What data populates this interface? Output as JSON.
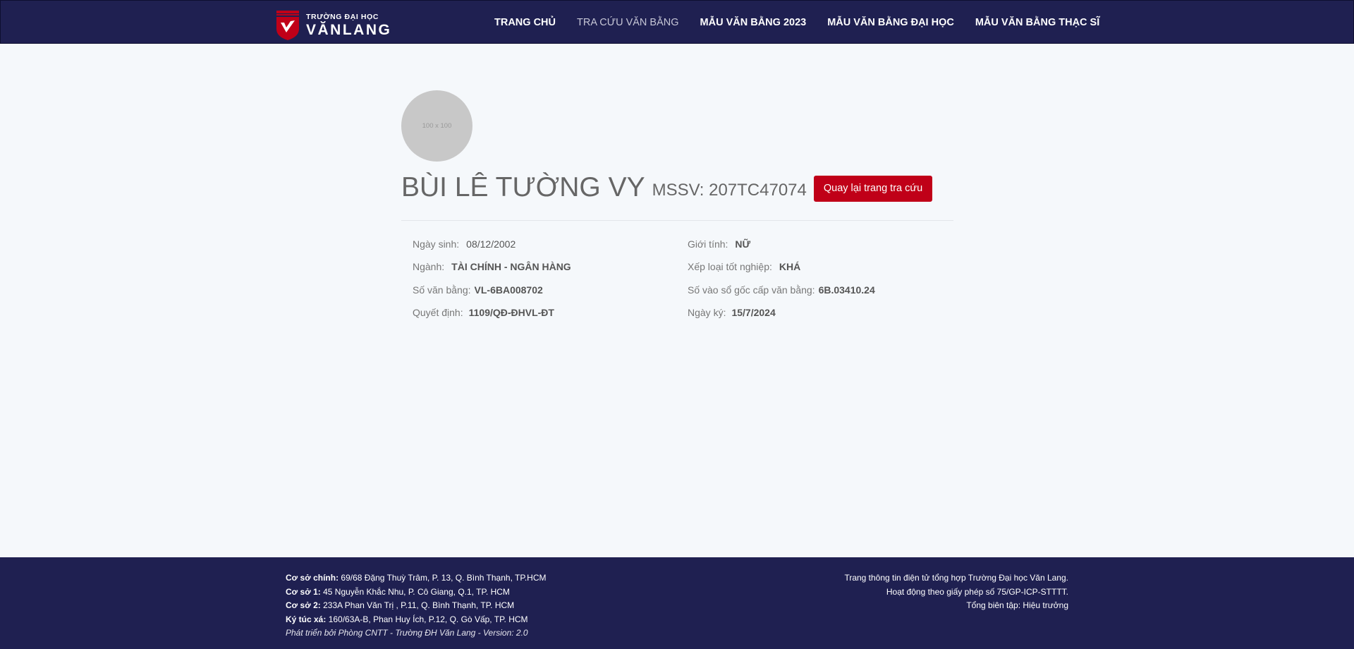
{
  "brand": {
    "line1": "TRƯỜNG ĐẠI HỌC",
    "line2": "VĂNLANG",
    "color": "#1f2051",
    "accent": "#c00018"
  },
  "nav": [
    {
      "label": "TRANG CHỦ"
    },
    {
      "label": "TRA CỨU VĂN BẰNG"
    },
    {
      "label": "MẪU VĂN BẰNG 2023"
    },
    {
      "label": "MẪU VĂN BẰNG ĐẠI HỌC"
    },
    {
      "label": "MẪU VĂN BẰNG THẠC SĨ"
    }
  ],
  "profile": {
    "avatar_text": "100 x 100",
    "name": "BÙI LÊ TƯỜNG VY",
    "mssv_label": "MSSV:",
    "mssv": "207TC47074",
    "back_button": "Quay lại trang tra cứu"
  },
  "details": {
    "birth": {
      "label": "Ngày sinh:",
      "value": "08/12/2002"
    },
    "gender": {
      "label": "Giới tính:",
      "value": "NỮ"
    },
    "major": {
      "label": "Ngành:",
      "value": "TÀI CHÍNH - NGÂN HÀNG"
    },
    "rank": {
      "label": "Xếp loại tốt nghiệp:",
      "value": "KHÁ"
    },
    "diploma_no": {
      "label": "Số văn bằng:",
      "value": "VL-6BA008702"
    },
    "register_no": {
      "label": "Số vào sổ gốc cấp văn bằng:",
      "value": "6B.03410.24"
    },
    "decision": {
      "label": "Quyết định:",
      "value": "1109/QĐ-ĐHVL-ĐT"
    },
    "sign_date": {
      "label": "Ngày ký:",
      "value": "15/7/2024"
    }
  },
  "footer": {
    "campuses": [
      {
        "label": "Cơ sở chính:",
        "value": "69/68 Đặng Thuỳ Trâm, P. 13, Q. Bình Thạnh, TP.HCM"
      },
      {
        "label": "Cơ sở 1:",
        "value": "45 Nguyễn Khắc Nhu, P. Cô Giang, Q.1, TP. HCM"
      },
      {
        "label": "Cơ sở 2:",
        "value": "233A Phan Văn Trị , P.11, Q. Bình Thạnh, TP. HCM"
      },
      {
        "label": "Ký túc xá:",
        "value": "160/63A-B, Phan Huy Ích, P.12, Q. Gò Vấp, TP. HCM"
      }
    ],
    "developer": "Phát triển bởi Phòng CNTT - Trường ĐH Văn Lang - Version: 2.0",
    "right": [
      "Trang thông tin điện tử tổng hợp Trường Đại học Văn Lang.",
      "Hoạt động theo giấy phép số 75/GP-ICP-STTTT.",
      "Tổng biên tập: Hiệu trưởng"
    ]
  }
}
